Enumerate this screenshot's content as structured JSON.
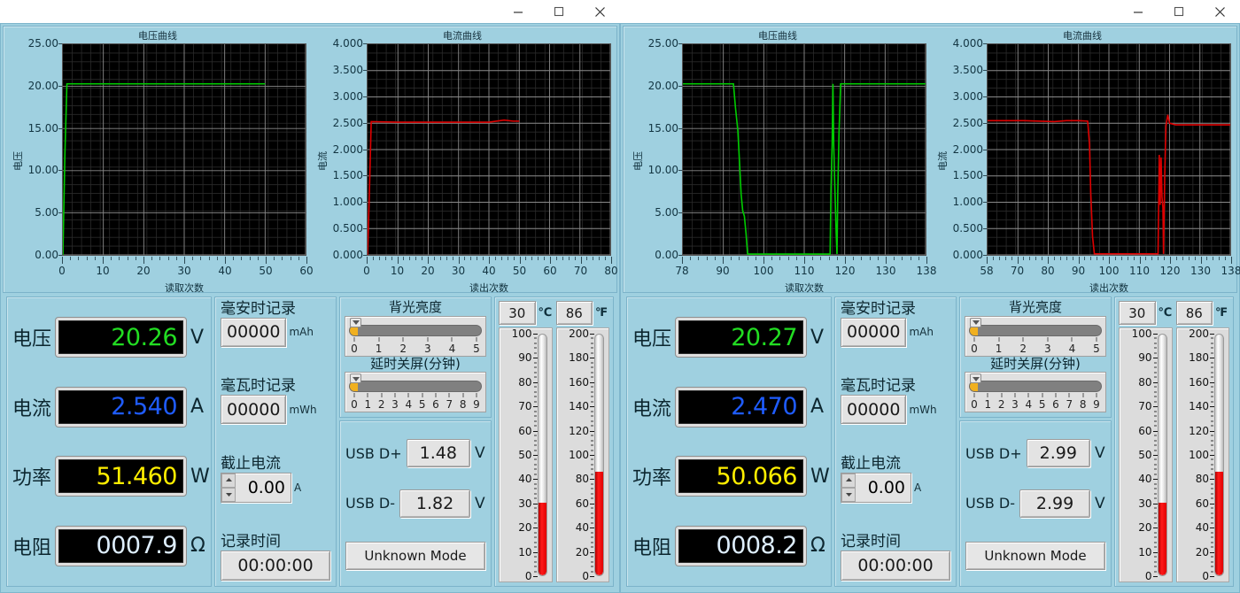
{
  "windows": [
    {
      "id": "left",
      "titlebar": {
        "minimize": "minimize-icon",
        "maximize": "maximize-icon",
        "close": "close-icon"
      },
      "charts": [
        {
          "title": "电压曲线",
          "ylabel": "电压",
          "xlabel": "读取次数",
          "yticks": [
            "25.00",
            "20.00",
            "15.00",
            "10.00",
            "5.00",
            "0.00"
          ],
          "xticks": [
            "0",
            "10",
            "20",
            "30",
            "40",
            "50",
            "60"
          ]
        },
        {
          "title": "电流曲线",
          "ylabel": "电流",
          "xlabel": "读出次数",
          "yticks": [
            "4.000",
            "3.500",
            "3.000",
            "2.500",
            "2.000",
            "1.500",
            "1.000",
            "0.500",
            "0.000"
          ],
          "xticks": [
            "0",
            "10",
            "20",
            "30",
            "40",
            "50",
            "60",
            "70",
            "80"
          ]
        }
      ],
      "meters": [
        {
          "label": "电压",
          "value": "20.26",
          "unit": "V",
          "color": "#22dd22"
        },
        {
          "label": "电流",
          "value": "2.540",
          "unit": "A",
          "color": "#1f5cff"
        },
        {
          "label": "功率",
          "value": "51.460",
          "unit": "W",
          "color": "#ffee00"
        },
        {
          "label": "电阻",
          "value": "0007.9",
          "unit": "Ω",
          "color": "#dfefff"
        }
      ],
      "records": {
        "mah_label": "毫安时记录",
        "mah_value": "00000",
        "mah_unit": "mAh",
        "mwh_label": "毫瓦时记录",
        "mwh_value": "00000",
        "mwh_unit": "mWh",
        "cutoff_label": "截止电流",
        "cutoff_value": "0.00",
        "cutoff_unit": "A",
        "time_label": "记录时间",
        "time_value": "00:00:00"
      },
      "controls": {
        "backlight_label": "背光亮度",
        "backlight_ticks": [
          "0",
          "1",
          "2",
          "3",
          "4",
          "5"
        ],
        "backlight_value": 0,
        "sleep_label": "延时关屏(分钟)",
        "sleep_ticks": [
          "0",
          "1",
          "2",
          "3",
          "4",
          "5",
          "6",
          "7",
          "8",
          "9"
        ],
        "sleep_value": 0,
        "usb_dplus_label": "USB D+",
        "usb_dplus_value": "1.48",
        "usb_dplus_unit": "V",
        "usb_dminus_label": "USB D-",
        "usb_dminus_value": "1.82",
        "usb_dminus_unit": "V",
        "mode_label": "Unknown Mode"
      },
      "thermos": [
        {
          "digit": "30",
          "unit": "℃",
          "labels": [
            "100",
            "90",
            "80",
            "70",
            "60",
            "50",
            "40",
            "30",
            "20",
            "10",
            "0"
          ],
          "value": 30,
          "min": 0,
          "max": 100
        },
        {
          "digit": "86",
          "unit": "℉",
          "labels": [
            "200",
            "180",
            "160",
            "140",
            "120",
            "100",
            "80",
            "60",
            "40",
            "20",
            "0"
          ],
          "value": 86,
          "min": 0,
          "max": 200
        }
      ]
    },
    {
      "id": "right",
      "titlebar": {
        "minimize": "minimize-icon",
        "maximize": "maximize-icon",
        "close": "close-icon"
      },
      "charts": [
        {
          "title": "电压曲线",
          "ylabel": "电压",
          "xlabel": "读取次数",
          "yticks": [
            "25.00",
            "20.00",
            "15.00",
            "10.00",
            "5.00",
            "0.00"
          ],
          "xticks": [
            "78",
            "90",
            "100",
            "110",
            "120",
            "130",
            "138"
          ]
        },
        {
          "title": "电流曲线",
          "ylabel": "电流",
          "xlabel": "读出次数",
          "yticks": [
            "4.000",
            "3.500",
            "3.000",
            "2.500",
            "2.000",
            "1.500",
            "1.000",
            "0.500",
            "0.000"
          ],
          "xticks": [
            "58",
            "70",
            "80",
            "90",
            "100",
            "110",
            "120",
            "130",
            "138"
          ]
        }
      ],
      "meters": [
        {
          "label": "电压",
          "value": "20.27",
          "unit": "V",
          "color": "#22dd22"
        },
        {
          "label": "电流",
          "value": "2.470",
          "unit": "A",
          "color": "#1f5cff"
        },
        {
          "label": "功率",
          "value": "50.066",
          "unit": "W",
          "color": "#ffee00"
        },
        {
          "label": "电阻",
          "value": "0008.2",
          "unit": "Ω",
          "color": "#dfefff"
        }
      ],
      "records": {
        "mah_label": "毫安时记录",
        "mah_value": "00000",
        "mah_unit": "mAh",
        "mwh_label": "毫瓦时记录",
        "mwh_value": "00000",
        "mwh_unit": "mWh",
        "cutoff_label": "截止电流",
        "cutoff_value": "0.00",
        "cutoff_unit": "A",
        "time_label": "记录时间",
        "time_value": "00:00:00"
      },
      "controls": {
        "backlight_label": "背光亮度",
        "backlight_ticks": [
          "0",
          "1",
          "2",
          "3",
          "4",
          "5"
        ],
        "backlight_value": 0,
        "sleep_label": "延时关屏(分钟)",
        "sleep_ticks": [
          "0",
          "1",
          "2",
          "3",
          "4",
          "5",
          "6",
          "7",
          "8",
          "9"
        ],
        "sleep_value": 0,
        "usb_dplus_label": "USB D+",
        "usb_dplus_value": "2.99",
        "usb_dplus_unit": "V",
        "usb_dminus_label": "USB D-",
        "usb_dminus_value": "2.99",
        "usb_dminus_unit": "V",
        "mode_label": "Unknown Mode"
      },
      "thermos": [
        {
          "digit": "30",
          "unit": "℃",
          "labels": [
            "100",
            "90",
            "80",
            "70",
            "60",
            "50",
            "40",
            "30",
            "20",
            "10",
            "0"
          ],
          "value": 30,
          "min": 0,
          "max": 100
        },
        {
          "digit": "86",
          "unit": "℉",
          "labels": [
            "200",
            "180",
            "160",
            "140",
            "120",
            "100",
            "80",
            "60",
            "40",
            "20",
            "0"
          ],
          "value": 86,
          "min": 0,
          "max": 200
        }
      ]
    }
  ],
  "chart_data": [
    {
      "type": "line",
      "title": "电压曲线",
      "xlabel": "读取次数",
      "ylabel": "电压",
      "xlim": [
        0,
        60
      ],
      "ylim": [
        0,
        25
      ],
      "grid": true,
      "color": "#00cc00",
      "series": [
        {
          "name": "电压",
          "x": [
            0,
            0.5,
            1,
            2,
            10,
            20,
            30,
            40,
            48,
            50
          ],
          "y": [
            0,
            12,
            20.3,
            20.3,
            20.3,
            20.3,
            20.3,
            20.3,
            20.3,
            20.3
          ]
        }
      ]
    },
    {
      "type": "line",
      "title": "电流曲线",
      "xlabel": "读出次数",
      "ylabel": "电流",
      "xlim": [
        0,
        80
      ],
      "ylim": [
        0,
        4
      ],
      "grid": true,
      "color": "#dd0000",
      "series": [
        {
          "name": "电流",
          "x": [
            0,
            0.6,
            1.2,
            10,
            20,
            30,
            40,
            45,
            48,
            50
          ],
          "y": [
            0,
            1.2,
            2.53,
            2.52,
            2.52,
            2.52,
            2.52,
            2.56,
            2.54,
            2.54
          ]
        }
      ]
    },
    {
      "type": "line",
      "title": "电压曲线",
      "xlabel": "读取次数",
      "ylabel": "电压",
      "xlim": [
        78,
        138
      ],
      "ylim": [
        0,
        25
      ],
      "grid": true,
      "color": "#00cc00",
      "series": [
        {
          "name": "电压",
          "x": [
            78,
            88,
            90.5,
            91,
            91.6,
            92,
            92.4,
            92.8,
            93.2,
            93.6,
            94,
            100,
            110,
            114.4,
            114.6,
            114.9,
            115.1,
            115.3,
            115.6,
            115.9,
            116.1,
            116.3,
            116.6,
            117,
            120,
            130,
            138
          ],
          "y": [
            20.3,
            20.3,
            20.3,
            17.5,
            14.7,
            11.0,
            7.2,
            5.2,
            4.6,
            2.6,
            0.1,
            0.1,
            0.1,
            0.1,
            7.5,
            13.0,
            20.3,
            13.0,
            7.5,
            2.6,
            0.1,
            7.5,
            14.5,
            20.3,
            20.3,
            20.3,
            20.3
          ]
        }
      ]
    },
    {
      "type": "line",
      "title": "电流曲线",
      "xlabel": "读出次数",
      "ylabel": "电流",
      "xlim": [
        58,
        138
      ],
      "ylim": [
        0,
        4
      ],
      "grid": true,
      "color": "#dd0000",
      "series": [
        {
          "name": "电流",
          "x": [
            58,
            70,
            80,
            84,
            88,
            91,
            91.6,
            92,
            92.6,
            93.2,
            100,
            110,
            114.2,
            114.6,
            114.9,
            115.2,
            115.5,
            115.8,
            116,
            116.4,
            116.8,
            117.4,
            118,
            120,
            130,
            138
          ],
          "y": [
            2.55,
            2.55,
            2.53,
            2.55,
            2.55,
            2.54,
            2.1,
            1.2,
            0.35,
            0.02,
            0.02,
            0.02,
            0.02,
            1.9,
            0.95,
            1.85,
            1.1,
            0.9,
            0.02,
            1.5,
            2.45,
            2.66,
            2.5,
            2.47,
            2.47,
            2.47
          ]
        }
      ]
    }
  ]
}
